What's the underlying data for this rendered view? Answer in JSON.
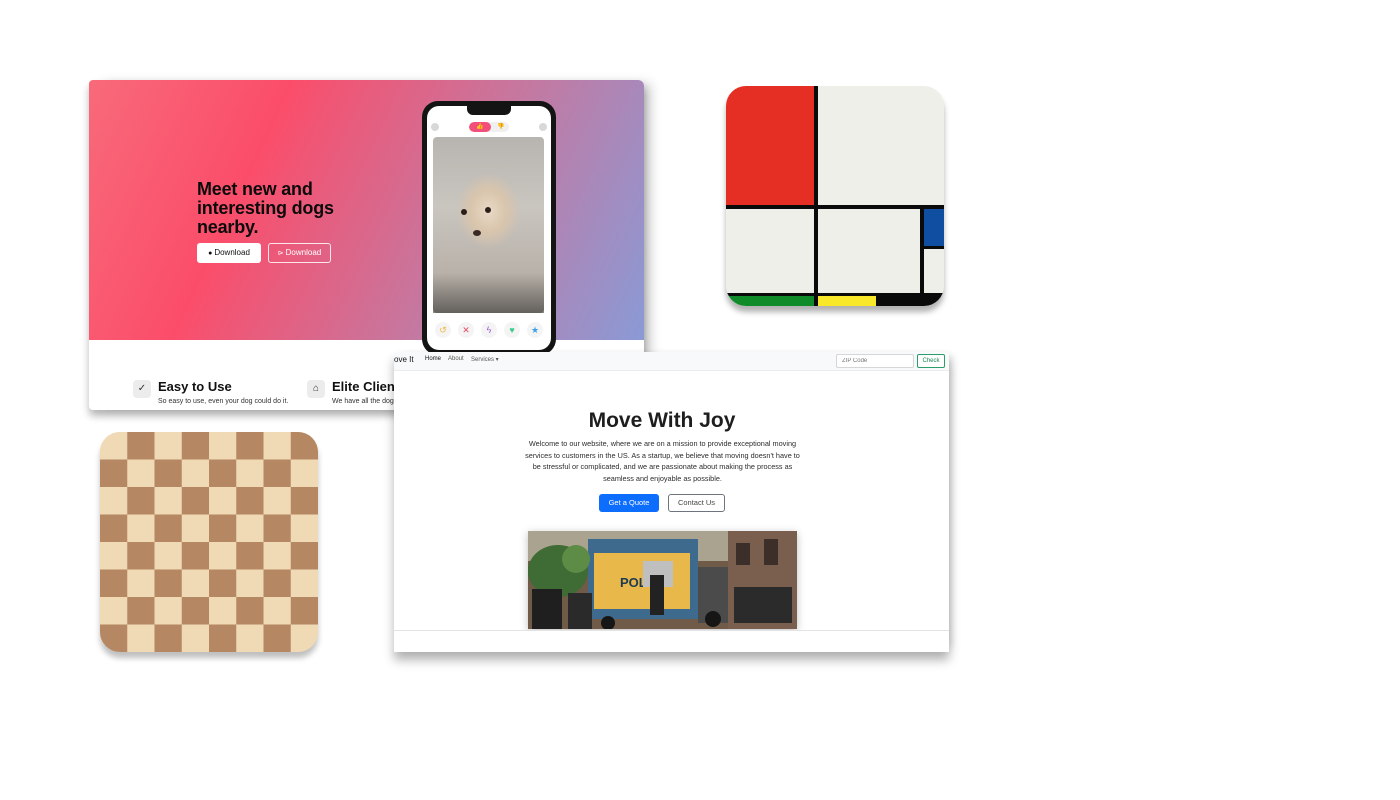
{
  "dog_app": {
    "headline": "Meet new and interesting dogs nearby.",
    "download_apple": "Download",
    "download_play": "Download",
    "apple_icon": "",
    "play_icon": "⊳",
    "toggle_on": "👍",
    "toggle_off": "👎",
    "features": [
      {
        "icon": "check-circle-icon",
        "glyph": "✓",
        "title": "Easy to Use",
        "subtitle": "So easy to use, even your dog could do it."
      },
      {
        "icon": "graduation-cap-icon",
        "glyph": "🎓",
        "title": "Elite Clientele",
        "subtitle": "We have all the dogs, the greatest dogs."
      }
    ],
    "actions": [
      {
        "name": "rewind-icon",
        "glyph": "↺",
        "color": "#f0b83a"
      },
      {
        "name": "nope-icon",
        "glyph": "✕",
        "color": "#e84a5f"
      },
      {
        "name": "boost-icon",
        "glyph": "ϟ",
        "color": "#9b59d0"
      },
      {
        "name": "like-icon",
        "glyph": "♥",
        "color": "#3ec98f"
      },
      {
        "name": "superlike-icon",
        "glyph": "★",
        "color": "#3aa0e8"
      }
    ],
    "colors": {
      "hero_start": "#f86a7a",
      "hero_mid": "#fb4d6a",
      "hero_end": "#8a9ad6"
    }
  },
  "mondrian": {
    "colors": {
      "red": "#e52f24",
      "blue": "#0f4ea0",
      "yellow": "#f9e82a",
      "green": "#0f8b2a",
      "off_white": "#efefe9",
      "black": "#0a0a0a"
    }
  },
  "checkerboard": {
    "rows": 8,
    "cols": 8,
    "colors": {
      "light": "#f0d9b5",
      "dark": "#b58863"
    }
  },
  "move_it": {
    "brand": "ove It",
    "nav": {
      "home": "Home",
      "about": "About",
      "services": "Services ▾"
    },
    "zip_placeholder": "ZIP Code",
    "check_label": "Check",
    "title": "Move With Joy",
    "description": "Welcome to our website, where we are on a mission to provide exceptional moving services to customers in the US. As a startup, we believe that moving doesn't have to be stressful or complicated, and we are passionate about making the process as seamless and enjoyable as possible.",
    "quote_label": "Get a Quote",
    "contact_label": "Contact Us",
    "truck_text": "POLIS",
    "colors": {
      "primary": "#0d6efd",
      "success": "#198754"
    }
  }
}
